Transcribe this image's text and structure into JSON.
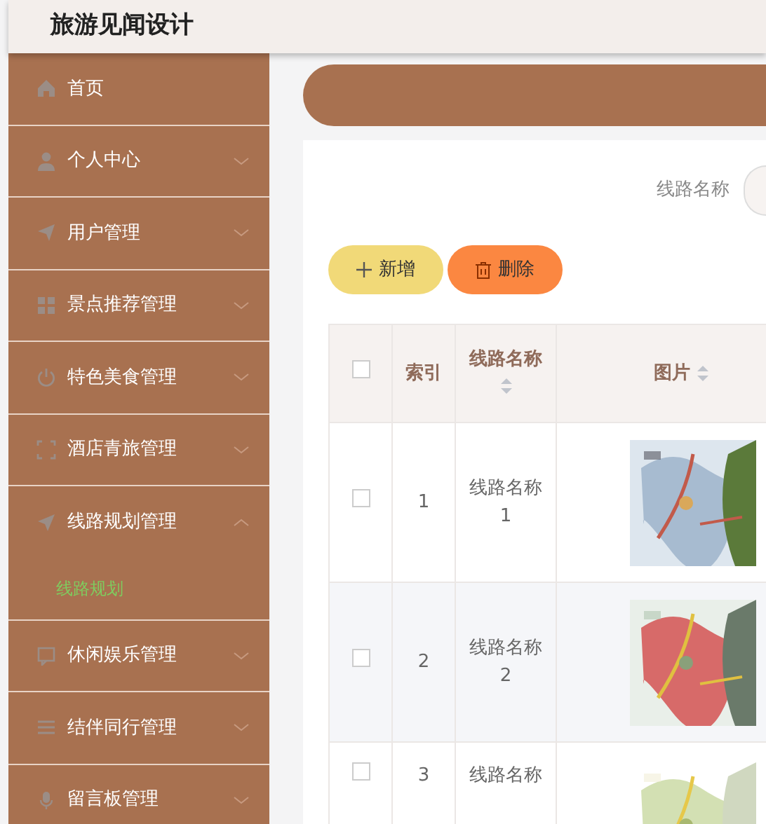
{
  "header": {
    "title": "旅游见闻设计"
  },
  "sidebar": {
    "items": [
      {
        "label": "首页",
        "kind": "home"
      },
      {
        "label": "个人中心",
        "kind": "user",
        "expanded": false
      },
      {
        "label": "用户管理",
        "kind": "send",
        "expanded": false
      },
      {
        "label": "景点推荐管理",
        "kind": "grid",
        "expanded": false
      },
      {
        "label": "特色美食管理",
        "kind": "power",
        "expanded": false
      },
      {
        "label": "酒店青旅管理",
        "kind": "frame",
        "expanded": false
      },
      {
        "label": "线路规划管理",
        "kind": "navigate",
        "expanded": true,
        "children": [
          {
            "label": "线路规划",
            "selected": true
          }
        ]
      },
      {
        "label": "休闲娱乐管理",
        "kind": "chat",
        "expanded": false
      },
      {
        "label": "结伴同行管理",
        "kind": "list",
        "expanded": false
      },
      {
        "label": "留言板管理",
        "kind": "mic",
        "expanded": false
      }
    ]
  },
  "search": {
    "label": "线路名称"
  },
  "buttons": [
    {
      "label": "新增",
      "kind": "add"
    },
    {
      "label": "删除",
      "kind": "delete"
    }
  ],
  "table": {
    "columns": [
      {
        "kind": "check",
        "checked": false
      },
      {
        "label": "索引",
        "kind": "index"
      },
      {
        "label": "线路名称",
        "kind": "sort"
      },
      {
        "label": "图片",
        "kind": "sort"
      }
    ],
    "rows": [
      {
        "checked": false,
        "index": "1",
        "name": "线路名称 1"
      },
      {
        "checked": false,
        "index": "2",
        "name": "线路名称 2"
      },
      {
        "checked": false,
        "index": "3",
        "name": "线路名称"
      }
    ]
  }
}
